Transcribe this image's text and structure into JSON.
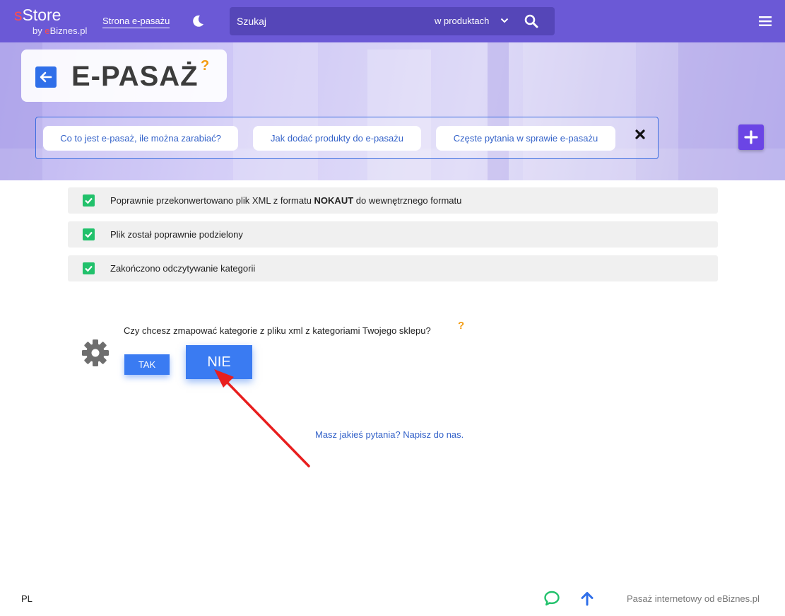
{
  "header": {
    "logo_prefix": "s",
    "logo_main": "Store",
    "logo_by": "by ",
    "logo_e": "e",
    "logo_brand": "Biznes.pl",
    "nav_link": "Strona e-pasażu",
    "search_placeholder": "Szukaj",
    "search_scope": "w produktach",
    "icons": [
      "moon-icon",
      "chevron-down-icon",
      "search-icon",
      "hamburger-icon"
    ]
  },
  "hero": {
    "title": "E-PASAŻ",
    "title_help": "?",
    "help_links": [
      {
        "label": "Co to jest e-pasaż, ile można zarabiać?"
      },
      {
        "label": "Jak dodać produkty do e-pasażu"
      },
      {
        "label": "Częste pytania w sprawie e-pasażu"
      }
    ],
    "icons": [
      "back-arrow-icon",
      "close-icon",
      "plus-icon"
    ]
  },
  "status": [
    {
      "before": "Poprawnie przekonwertowano plik XML z formatu ",
      "bold": "NOKAUT",
      "after": " do wewnętrznego formatu"
    },
    {
      "before": "Plik został poprawnie podzielony",
      "bold": "",
      "after": ""
    },
    {
      "before": "Zakończono odczytywanie kategorii",
      "bold": "",
      "after": ""
    }
  ],
  "mapping": {
    "question": "Czy chcesz zmapować kategorie z pliku xml z kategoriami Twojego sklepu?",
    "help": "?",
    "yes_label": "TAK",
    "no_label": "NIE"
  },
  "contact_link": "Masz jakieś pytania? Napisz do nas.",
  "footer": {
    "lang": "PL",
    "credit": "Pasaż internetowy od eBiznes.pl"
  },
  "colors": {
    "topbar": "#6b59d6",
    "accent_blue": "#3a7bf2",
    "success_green": "#21c16b",
    "help_orange": "#f39c12",
    "add_purple": "#6b45e5",
    "annotation_red": "#e81e1e"
  }
}
